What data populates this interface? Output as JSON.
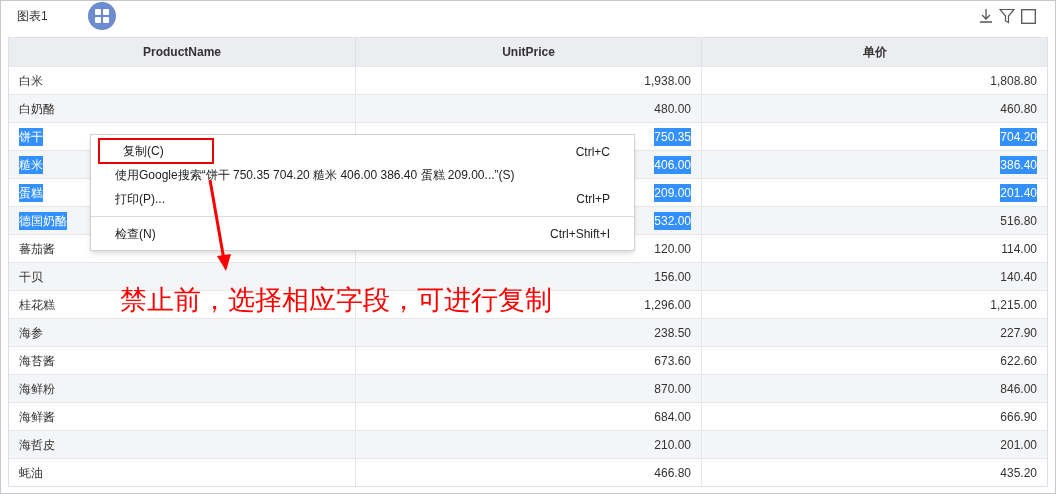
{
  "panel": {
    "title": "图表1"
  },
  "toolbar": [
    {
      "kind": "download"
    },
    {
      "kind": "filter"
    },
    {
      "kind": "maximize"
    }
  ],
  "table": {
    "columns": [
      "ProductName",
      "UnitPrice",
      "单价"
    ],
    "rows": [
      {
        "cells": [
          {
            "text": "白米",
            "selected": false
          },
          {
            "text": "1,938.00",
            "selected": false
          },
          {
            "text": "1,808.80",
            "selected": false
          }
        ]
      },
      {
        "cells": [
          {
            "text": "白奶酪",
            "selected": false
          },
          {
            "text": "480.00",
            "selected": false
          },
          {
            "text": "460.80",
            "selected": false
          }
        ]
      },
      {
        "cells": [
          {
            "text": "饼干",
            "selected": true
          },
          {
            "text": "750.35",
            "selected": true
          },
          {
            "text": "704.20",
            "selected": true
          }
        ]
      },
      {
        "cells": [
          {
            "text": "糙米",
            "selected": true
          },
          {
            "text": "406.00",
            "selected": true
          },
          {
            "text": "386.40",
            "selected": true
          }
        ]
      },
      {
        "cells": [
          {
            "text": "蛋糕",
            "selected": true
          },
          {
            "text": "209.00",
            "selected": true
          },
          {
            "text": "201.40",
            "selected": true
          }
        ]
      },
      {
        "cells": [
          {
            "text": "德国奶酪",
            "selected": true
          },
          {
            "text": "532.00",
            "selected": true
          },
          {
            "text": "516.80",
            "selected": false
          }
        ]
      },
      {
        "cells": [
          {
            "text": "蕃茄酱",
            "selected": false
          },
          {
            "text": "120.00",
            "selected": false
          },
          {
            "text": "114.00",
            "selected": false
          }
        ]
      },
      {
        "cells": [
          {
            "text": "干贝",
            "selected": false
          },
          {
            "text": "156.00",
            "selected": false
          },
          {
            "text": "140.40",
            "selected": false
          }
        ]
      },
      {
        "cells": [
          {
            "text": "桂花糕",
            "selected": false
          },
          {
            "text": "1,296.00",
            "selected": false
          },
          {
            "text": "1,215.00",
            "selected": false
          }
        ]
      },
      {
        "cells": [
          {
            "text": "海参",
            "selected": false
          },
          {
            "text": "238.50",
            "selected": false
          },
          {
            "text": "227.90",
            "selected": false
          }
        ]
      },
      {
        "cells": [
          {
            "text": "海苔酱",
            "selected": false
          },
          {
            "text": "673.60",
            "selected": false
          },
          {
            "text": "622.60",
            "selected": false
          }
        ]
      },
      {
        "cells": [
          {
            "text": "海鲜粉",
            "selected": false
          },
          {
            "text": "870.00",
            "selected": false
          },
          {
            "text": "846.00",
            "selected": false
          }
        ]
      },
      {
        "cells": [
          {
            "text": "海鲜酱",
            "selected": false
          },
          {
            "text": "684.00",
            "selected": false
          },
          {
            "text": "666.90",
            "selected": false
          }
        ]
      },
      {
        "cells": [
          {
            "text": "海哲皮",
            "selected": false
          },
          {
            "text": "210.00",
            "selected": false
          },
          {
            "text": "201.00",
            "selected": false
          }
        ]
      },
      {
        "cells": [
          {
            "text": "蚝油",
            "selected": false
          },
          {
            "text": "466.80",
            "selected": false
          },
          {
            "text": "435.20",
            "selected": false
          }
        ]
      }
    ]
  },
  "context_menu": {
    "items": [
      {
        "label": "复制(C)",
        "shortcut": "Ctrl+C",
        "boxed": true,
        "separator_before": false
      },
      {
        "label": "使用Google搜索“饼干 750.35 704.20 糙米 406.00 386.40 蛋糕 209.00...”(S)",
        "boxed": false,
        "separator_before": false
      },
      {
        "label": "打印(P)...",
        "shortcut": "Ctrl+P",
        "boxed": false,
        "separator_before": false
      },
      {
        "label": "检查(N)",
        "shortcut": "Ctrl+Shift+I",
        "boxed": false,
        "separator_before": true
      }
    ]
  },
  "annotation": {
    "text": "禁止前，选择相应字段，可进行复制"
  }
}
